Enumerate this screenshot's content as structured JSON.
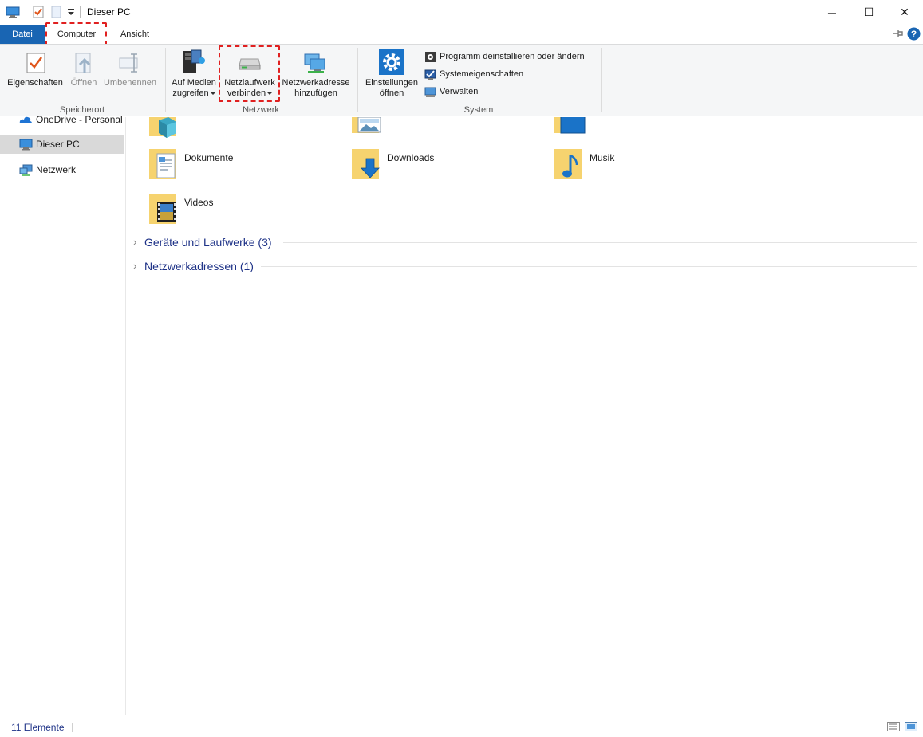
{
  "window": {
    "title": "Dieser PC",
    "controls": {
      "minimize": "─",
      "maximize": "☐",
      "close": "✕"
    }
  },
  "tabs": {
    "file": "Datei",
    "computer": "Computer",
    "view": "Ansicht"
  },
  "ribbon": {
    "groups": {
      "location": {
        "label": "Speicherort",
        "buttons": {
          "properties": "Eigenschaften",
          "open": "Öffnen",
          "rename": "Umbenennen"
        }
      },
      "network": {
        "label": "Netzwerk",
        "buttons": {
          "media_line1": "Auf Medien",
          "media_line2": "zugreifen",
          "map_drive_line1": "Netzlaufwerk",
          "map_drive_line2": "verbinden",
          "add_location_line1": "Netzwerkadresse",
          "add_location_line2": "hinzufügen"
        }
      },
      "system": {
        "label": "System",
        "buttons": {
          "settings_line1": "Einstellungen",
          "settings_line2": "öffnen",
          "uninstall": "Programm deinstallieren oder ändern",
          "system_properties": "Systemeigenschaften",
          "manage": "Verwalten"
        }
      }
    }
  },
  "sidebar": {
    "items": [
      {
        "label": "OneDrive - Personal",
        "icon": "onedrive-cloud-icon"
      },
      {
        "label": "Dieser PC",
        "icon": "this-pc-icon",
        "selected": true
      },
      {
        "label": "Netzwerk",
        "icon": "network-icon"
      }
    ]
  },
  "content": {
    "folders": [
      {
        "label": "Dokumente",
        "icon": "documents-folder-icon"
      },
      {
        "label": "Downloads",
        "icon": "downloads-folder-icon"
      },
      {
        "label": "Musik",
        "icon": "music-folder-icon"
      },
      {
        "label": "Videos",
        "icon": "videos-folder-icon"
      }
    ],
    "sections": [
      {
        "label": "Geräte und Laufwerke (3)"
      },
      {
        "label": "Netzwerkadressen (1)"
      }
    ]
  },
  "status": {
    "count": "11 Elemente"
  },
  "colors": {
    "accent": "#1965b3",
    "highlight": "#e02020",
    "section_text": "#1e3287",
    "ribbon_bg": "#f5f6f7"
  }
}
